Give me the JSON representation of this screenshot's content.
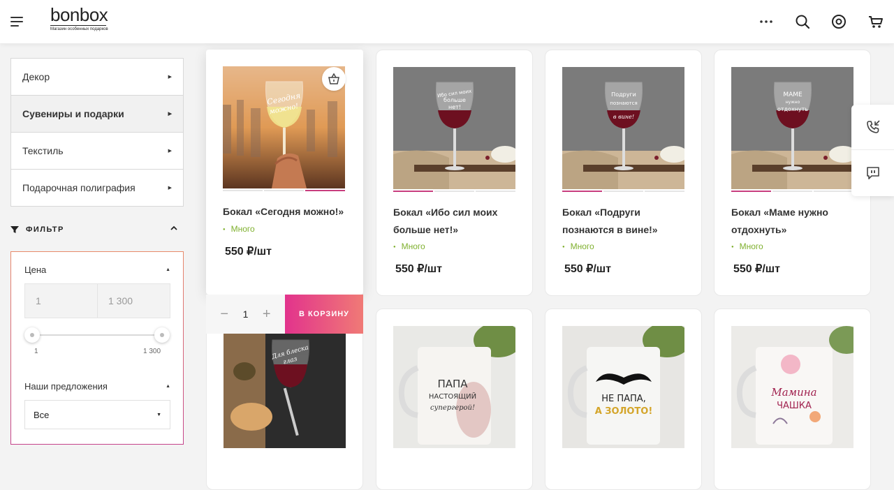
{
  "header": {
    "logo_text": "bonbox",
    "logo_subtitle": "Магазин особенных подарков",
    "icons": [
      "menu-icon",
      "more-icon",
      "search-icon",
      "account-icon",
      "cart-icon"
    ]
  },
  "sidebar": {
    "categories": [
      {
        "label": "Декор",
        "active": false
      },
      {
        "label": "Сувениры и подарки",
        "active": true
      },
      {
        "label": "Текстиль",
        "active": false
      },
      {
        "label": "Подарочная полиграфия",
        "active": false
      }
    ]
  },
  "filter": {
    "title": "ФИЛЬТР",
    "price_title": "Цена",
    "price_min": "1",
    "price_max": "1 300",
    "slider_min_label": "1",
    "slider_max_label": "1 300",
    "offers_title": "Наши предложения",
    "offers_selected": "Все"
  },
  "products": [
    {
      "name": "Бокал «Сегодня можно!»",
      "stock": "Много",
      "price": "550 ₽/шт"
    },
    {
      "name": "Бокал «Ибо сил моих больше нет!»",
      "stock": "Много",
      "price": "550 ₽/шт"
    },
    {
      "name": "Бокал «Подруги познаются в вине!»",
      "stock": "Много",
      "price": "550 ₽/шт"
    },
    {
      "name": "Бокал «Маме нужно отдохнуть»",
      "stock": "Много",
      "price": "550 ₽/шт"
    }
  ],
  "cart_bar": {
    "quantity": "1",
    "button_label": "В КОРЗИНУ"
  },
  "images": {
    "glass_texts": [
      "Сегодня можно!",
      "Ибо сил моих больше нет!",
      "Подруги познаются в вине!",
      "Маме нужно отдохнуть"
    ],
    "row2_texts": [
      "Для блеска глаз",
      "ПАПА настоящий супергерой!",
      "НЕ ПАПА, А ЗОЛОТО!",
      "Мамина ЧАШКА"
    ]
  },
  "colors": {
    "accent_gradient_start": "#e2338c",
    "accent_gradient_end": "#f07a76",
    "stock_green": "#7fb02e",
    "active_dot": "#c83e7e"
  }
}
